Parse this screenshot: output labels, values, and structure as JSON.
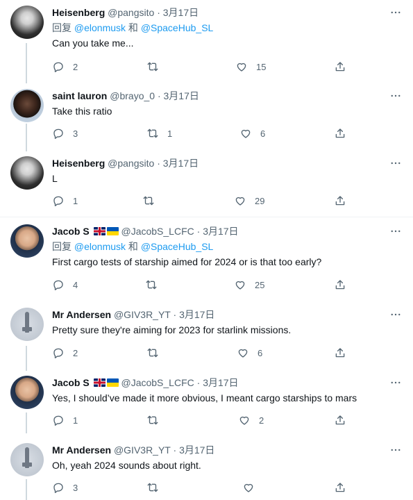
{
  "tweets": [
    {
      "name": "Heisenberg",
      "handle": "@pangsito",
      "sep": "·",
      "time": "3月17日",
      "reply_prefix": "回复 ",
      "reply_user1": "@elonmusk",
      "reply_and": " 和 ",
      "reply_user2": "@SpaceHub_SL",
      "text": "Can you take me...",
      "reply_count": "2",
      "retweet_count": "",
      "like_count": "15"
    },
    {
      "name": "saint lauron",
      "handle": "@brayo_0",
      "sep": "·",
      "time": "3月17日",
      "text": "Take this ratio",
      "reply_count": "3",
      "retweet_count": "1",
      "like_count": "6"
    },
    {
      "name": "Heisenberg",
      "handle": "@pangsito",
      "sep": "·",
      "time": "3月17日",
      "text": "L",
      "reply_count": "1",
      "retweet_count": "",
      "like_count": "29"
    },
    {
      "name": "Jacob S",
      "handle": "@JacobS_LCFC",
      "sep": "·",
      "time": "3月17日",
      "reply_prefix": "回复 ",
      "reply_user1": "@elonmusk",
      "reply_and": " 和 ",
      "reply_user2": "@SpaceHub_SL",
      "text": "First cargo tests of starship aimed for 2024 or is that too early?",
      "reply_count": "4",
      "retweet_count": "",
      "like_count": "25"
    },
    {
      "name": "Mr Andersen",
      "handle": "@GIV3R_YT",
      "sep": "·",
      "time": "3月17日",
      "text": "Pretty sure they're aiming for 2023 for starlink missions.",
      "reply_count": "2",
      "retweet_count": "",
      "like_count": "6"
    },
    {
      "name": "Jacob S",
      "handle": "@JacobS_LCFC",
      "sep": "·",
      "time": "3月17日",
      "text": "Yes, I should’ve made it more obvious, I meant cargo starships to mars",
      "reply_count": "1",
      "retweet_count": "",
      "like_count": "2"
    },
    {
      "name": "Mr Andersen",
      "handle": "@GIV3R_YT",
      "sep": "·",
      "time": "3月17日",
      "text": "Oh, yeah 2024 sounds about right.",
      "reply_count": "3",
      "retweet_count": "",
      "like_count": ""
    }
  ],
  "icons": {
    "reply": "reply-icon",
    "retweet": "retweet-icon",
    "like": "like-icon",
    "share": "share-icon",
    "more": "more-icon"
  },
  "colors": {
    "link": "#1d9bf0",
    "muted": "#536471",
    "text": "#0f1419"
  }
}
